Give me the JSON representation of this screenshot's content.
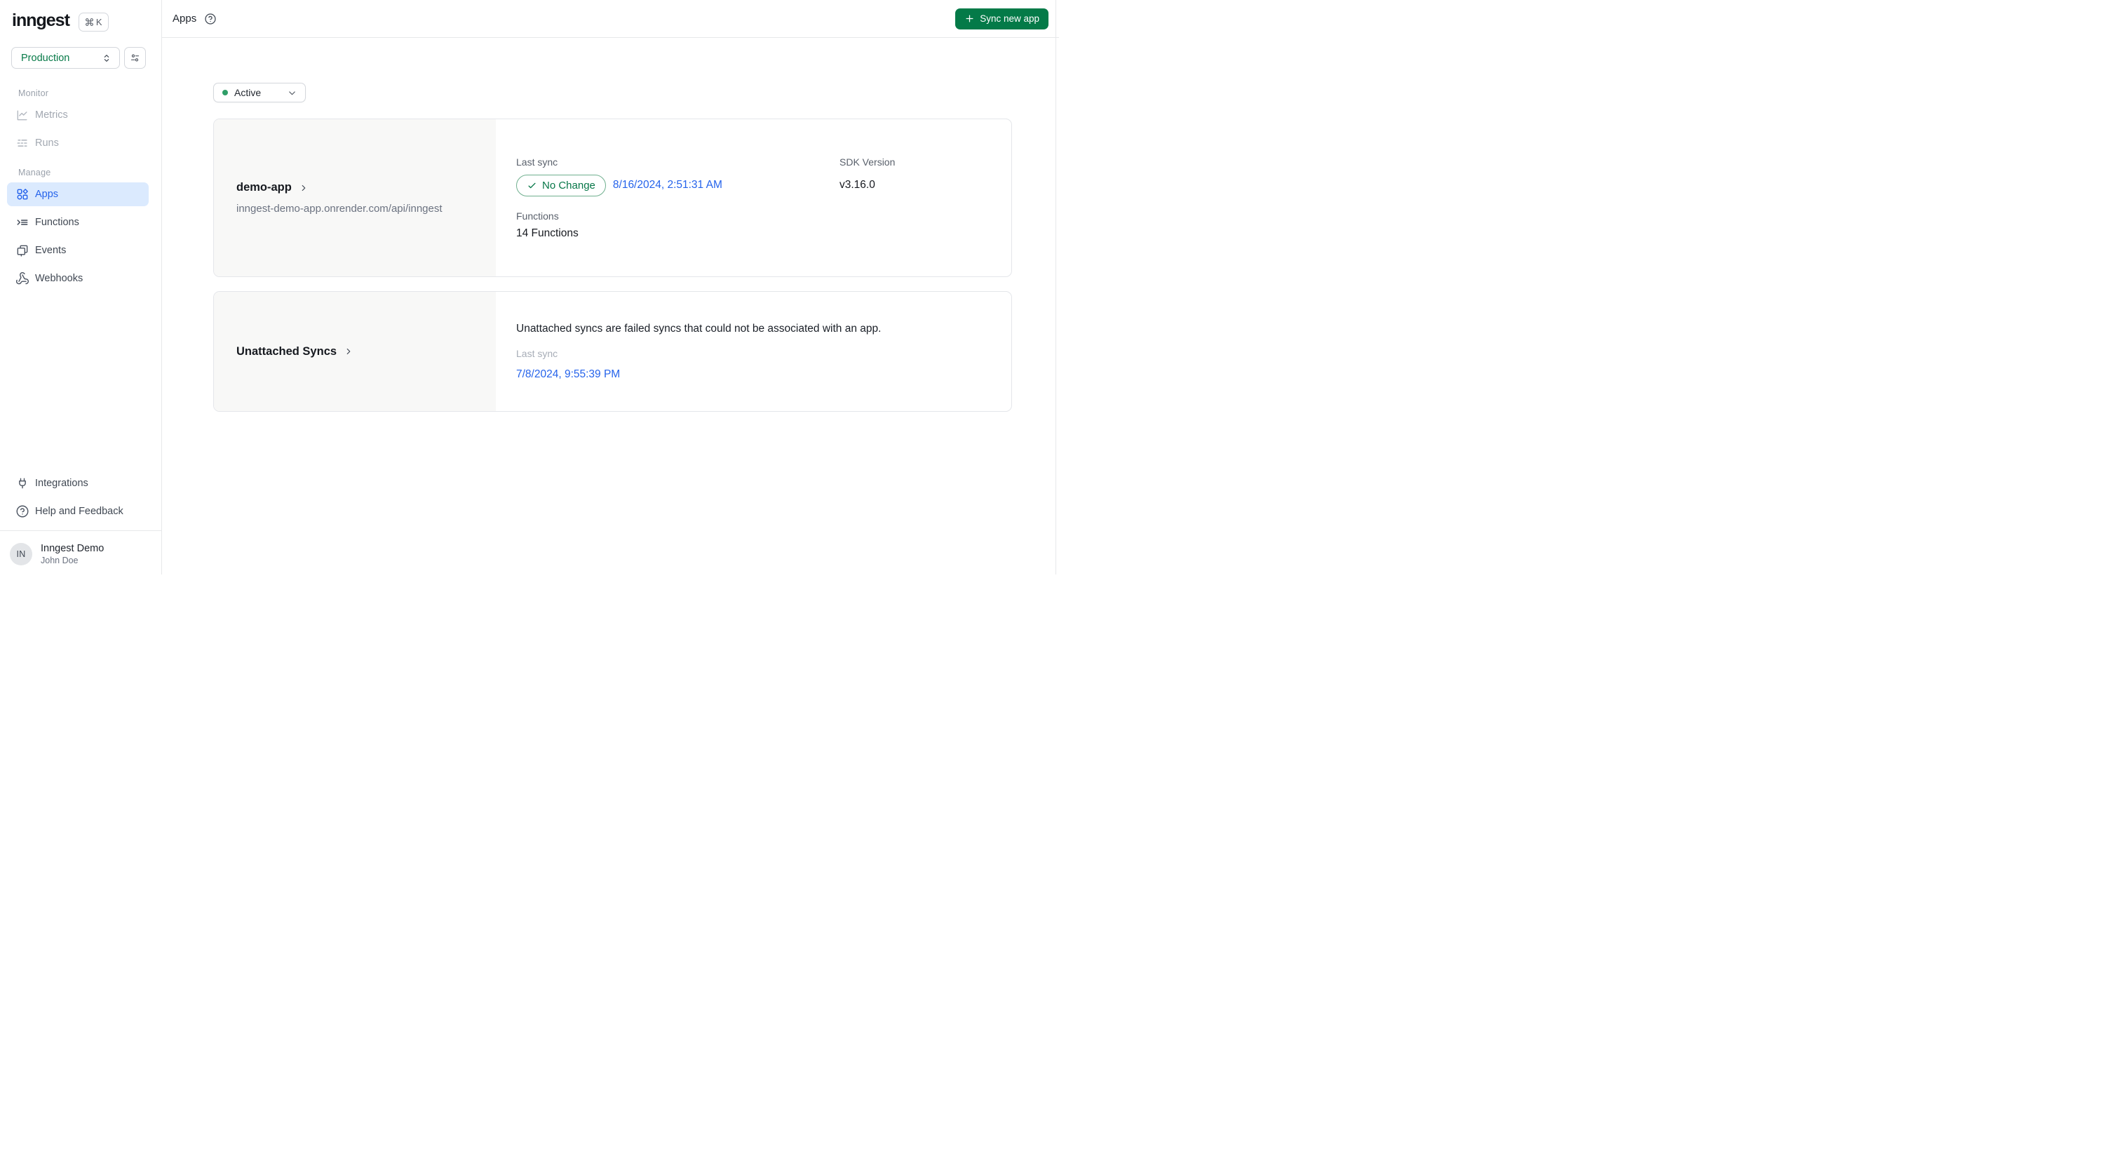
{
  "sidebar": {
    "logo_text": "inngest",
    "shortcut_key": "K",
    "environment": "Production",
    "sections": [
      {
        "label": "Monitor",
        "items": [
          {
            "label": "Metrics"
          },
          {
            "label": "Runs"
          }
        ]
      },
      {
        "label": "Manage",
        "items": [
          {
            "label": "Apps"
          },
          {
            "label": "Functions"
          },
          {
            "label": "Events"
          },
          {
            "label": "Webhooks"
          }
        ]
      }
    ],
    "footer": {
      "integrations": "Integrations",
      "help": "Help and Feedback"
    },
    "user": {
      "initials": "IN",
      "org_name": "Inngest Demo",
      "user_name": "John Doe"
    }
  },
  "header": {
    "title": "Apps",
    "sync_new_app": "Sync new app"
  },
  "filters": {
    "status": "Active"
  },
  "apps": [
    {
      "name": "demo-app",
      "url": "inngest-demo-app.onrender.com/api/inngest",
      "last_sync_label": "Last sync",
      "sync_status": "No Change",
      "last_sync_time": "8/16/2024, 2:51:31 AM",
      "functions_label": "Functions",
      "functions_count": "14 Functions",
      "sdk_version_label": "SDK Version",
      "sdk_version": "v3.16.0"
    }
  ],
  "unattached": {
    "title": "Unattached Syncs",
    "description": "Unattached syncs are failed syncs that could not be associated with an app.",
    "last_sync_label": "Last sync",
    "last_sync_time": "7/8/2024, 9:55:39 PM"
  },
  "colors": {
    "accent_green": "#047A48",
    "badge_green": "#067647",
    "status_dot_green": "#2F9E68",
    "link_blue": "#2563EB",
    "active_item_bg": "#DBEAFE",
    "active_item_text": "#2563EB",
    "border_gray": "#E7E8EA",
    "panel_gray": "#F8F8F7"
  }
}
